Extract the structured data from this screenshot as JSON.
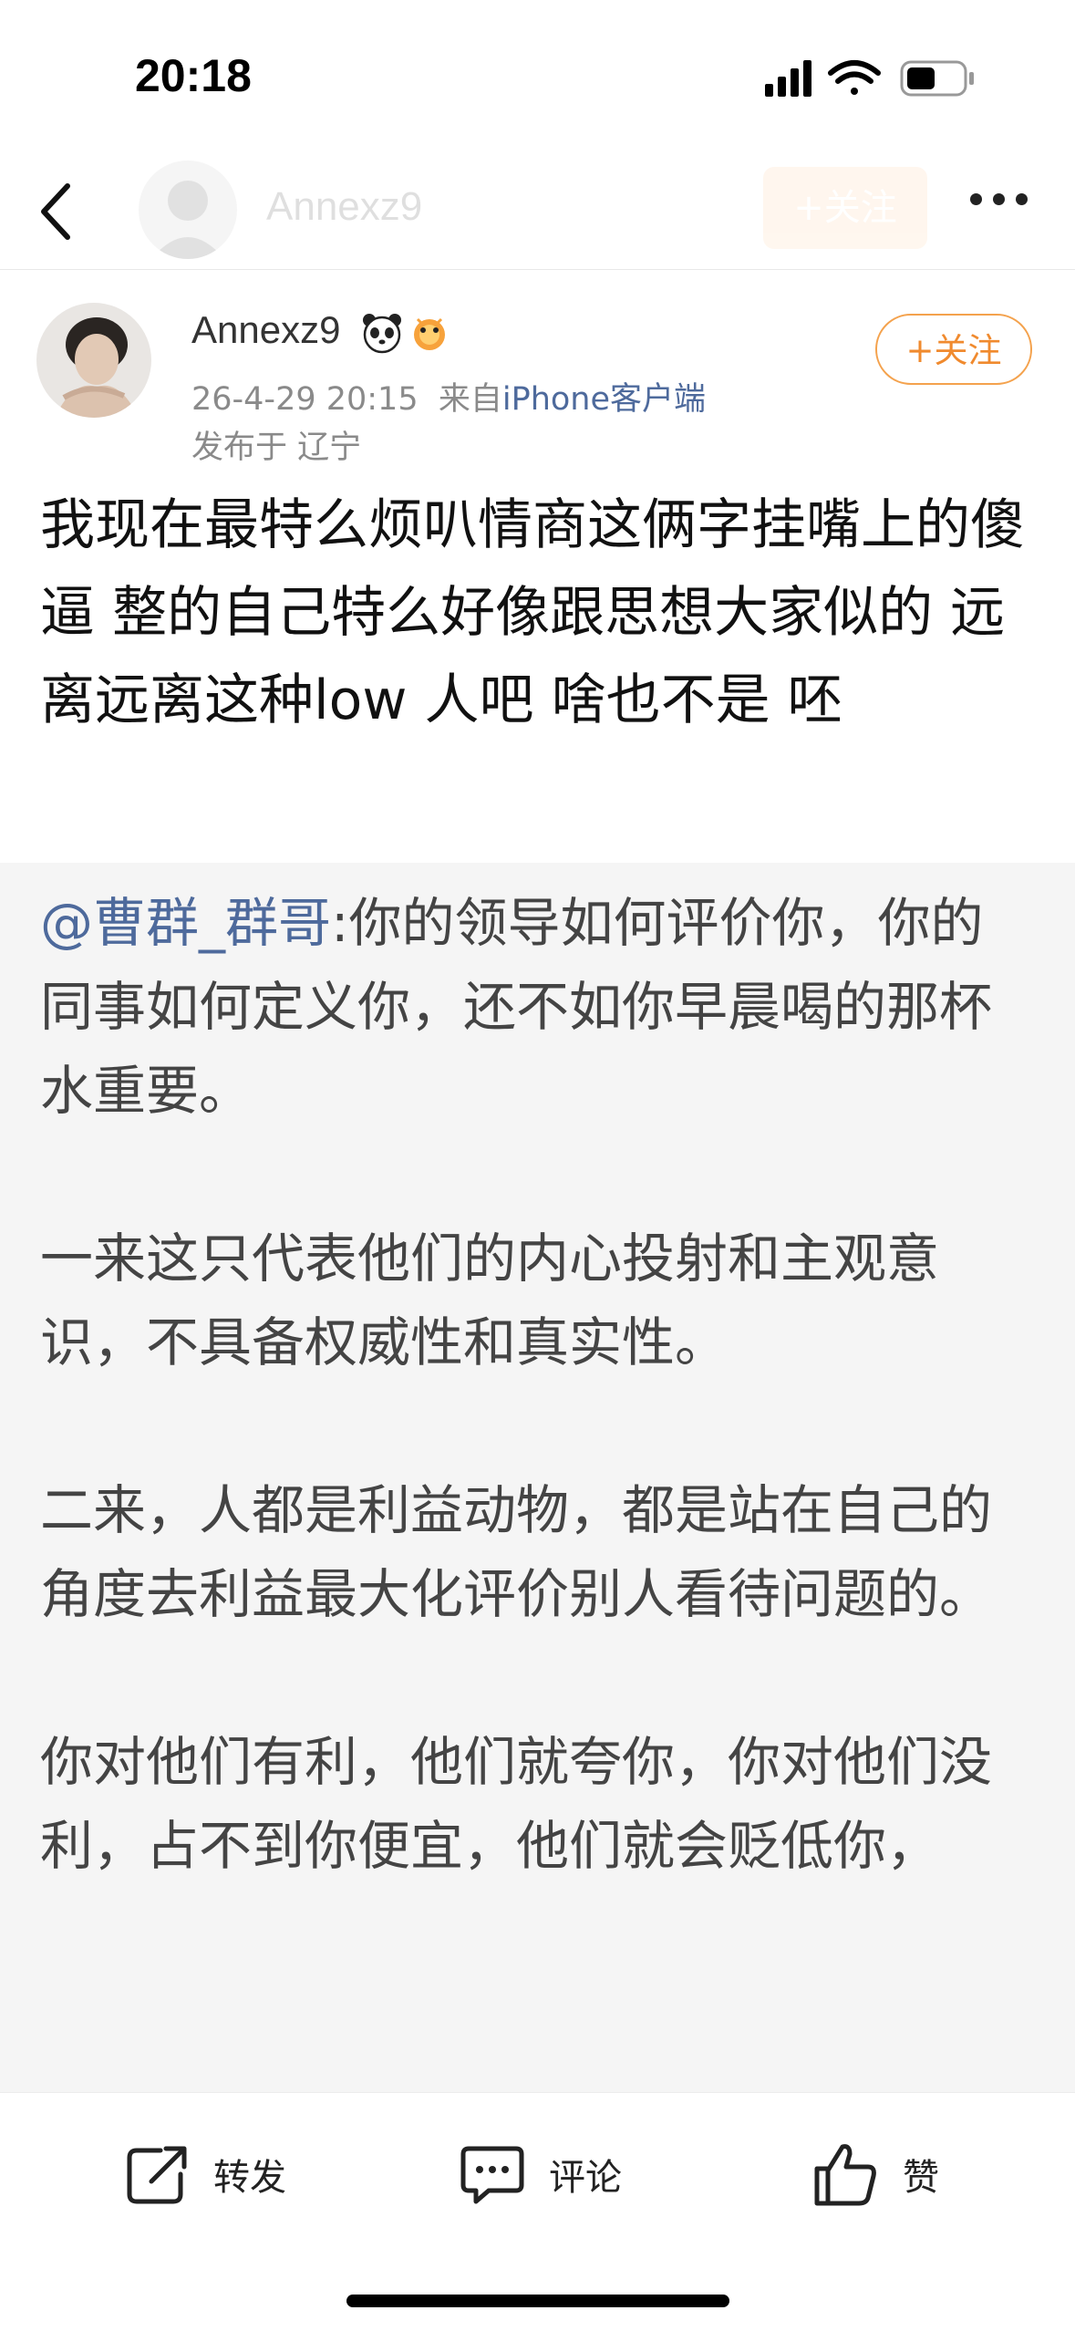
{
  "status_bar": {
    "time": "20:18"
  },
  "nav": {
    "title": "Annexz9",
    "follow_label": "+关注"
  },
  "post": {
    "author": "Annexz9",
    "timestamp": "26-4-29 20:15",
    "source_prefix": "来自",
    "source": "iPhone客户端",
    "location": "发布于 辽宁",
    "follow_label": "+关注",
    "text": "我现在最特么烦叭情商这俩字挂嘴上的傻逼 整的自己特么好像跟思想大家似的 远离远离这种low 人吧 啥也不是 呸"
  },
  "repost": {
    "mention": "@曹群_群哥",
    "paragraphs": [
      ":你的领导如何评价你，你的同事如何定义你，还不如你早晨喝的那杯水重要。",
      "一来这只代表他们的内心投射和主观意识，不具备权威性和真实性。",
      "二来，人都是利益动物，都是站在自己的角度去利益最大化评价别人看待问题的。",
      "你对他们有利，他们就夸你，你对他们没利，占不到你便宜，他们就会贬低你，"
    ]
  },
  "actions": {
    "repost_label": "转发",
    "comment_label": "评论",
    "like_label": "赞"
  },
  "colors": {
    "accent_orange": "#f08a2e",
    "link_blue": "#4e6a9c",
    "repost_bg": "#f5f5f5"
  }
}
